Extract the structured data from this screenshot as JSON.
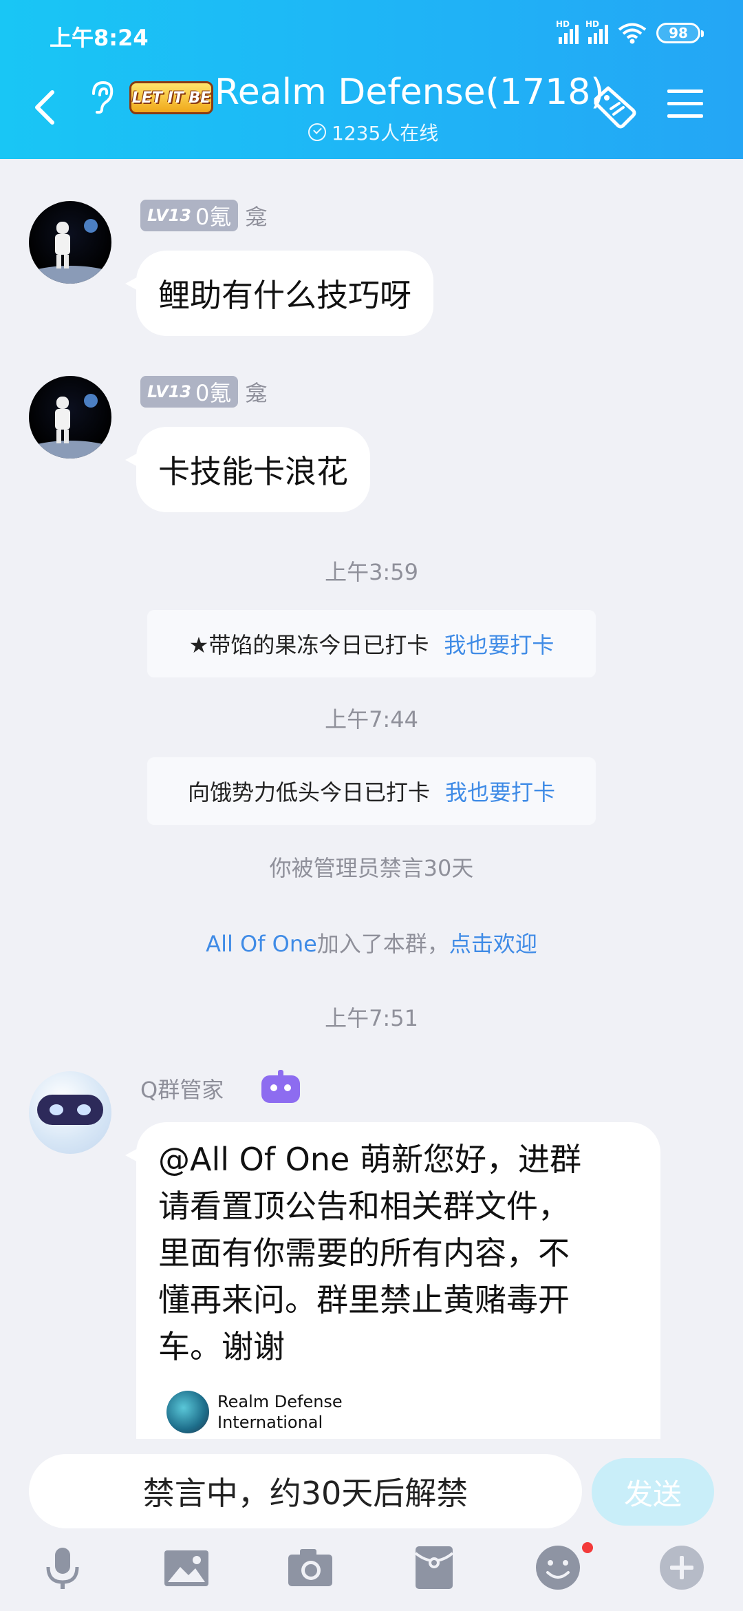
{
  "status_bar": {
    "time": "上午8:24",
    "battery": "98"
  },
  "header": {
    "badge_text": "LET IT BE",
    "group_title": "Realm Defense(1718)",
    "online_text": "1235人在线"
  },
  "messages": [
    {
      "level": "LV13",
      "title": "0氪",
      "sender": "龛",
      "text": "鲤助有什么技巧呀"
    },
    {
      "level": "LV13",
      "title": "0氪",
      "sender": "龛",
      "text": "卡技能卡浪花"
    }
  ],
  "time_separators": [
    "上午3:59",
    "上午7:44",
    "上午7:51"
  ],
  "checkins": [
    {
      "text": "★带馅的果冻今日已打卡",
      "link": "我也要打卡"
    },
    {
      "text": "向饿势力低头今日已打卡",
      "link": "我也要打卡"
    }
  ],
  "system": {
    "mute_notice": "你被管理员禁言30天",
    "join_name": "All Of One",
    "join_text": "加入了本群，",
    "welcome_link": "点击欢迎"
  },
  "bot": {
    "name": "Q群管家",
    "lines": [
      "@All Of One 萌新您好，进群",
      "请看置顶公告和相关群文件，",
      "里面有你需要的所有内容，不",
      "懂再来问。群里禁止黄赌毒开",
      "车。谢谢"
    ],
    "file_line1": "Realm Defense",
    "file_line2": "International"
  },
  "input": {
    "muted_text": "禁言中，约30天后解禁",
    "send_label": "发送"
  },
  "colors": {
    "header": "#1fb4f6",
    "link": "#3f8be6",
    "background": "#f0f1f6"
  },
  "toolbar_icons": [
    "microphone-icon",
    "image-icon",
    "camera-icon",
    "red-packet-icon",
    "emoji-icon",
    "plus-icon"
  ]
}
